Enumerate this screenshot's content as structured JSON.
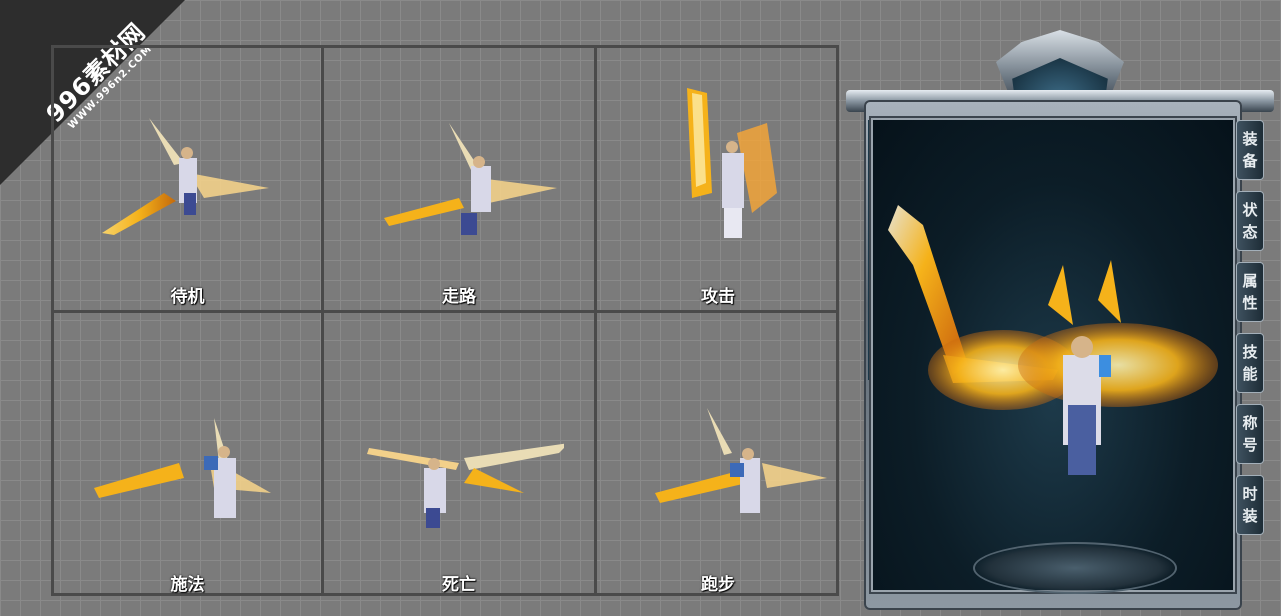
{
  "watermark": {
    "title": "996素材网",
    "url": "WWW.996n2.COM"
  },
  "poses": [
    {
      "label": "待机"
    },
    {
      "label": "走路"
    },
    {
      "label": "攻击"
    },
    {
      "label": "施法"
    },
    {
      "label": "死亡"
    },
    {
      "label": "跑步"
    }
  ],
  "panel": {
    "tabs": [
      {
        "c1": "装",
        "c2": "备"
      },
      {
        "c1": "状",
        "c2": "态"
      },
      {
        "c1": "属",
        "c2": "性"
      },
      {
        "c1": "技",
        "c2": "能"
      },
      {
        "c1": "称",
        "c2": "号"
      },
      {
        "c1": "时",
        "c2": "装"
      }
    ]
  },
  "colors": {
    "background": "#7b7b7b",
    "grid_border": "#4a4a4a",
    "frame_metal": "#8d98a2",
    "panel_dark": "#0c1d27",
    "flame_gold": "#f5b21a"
  }
}
